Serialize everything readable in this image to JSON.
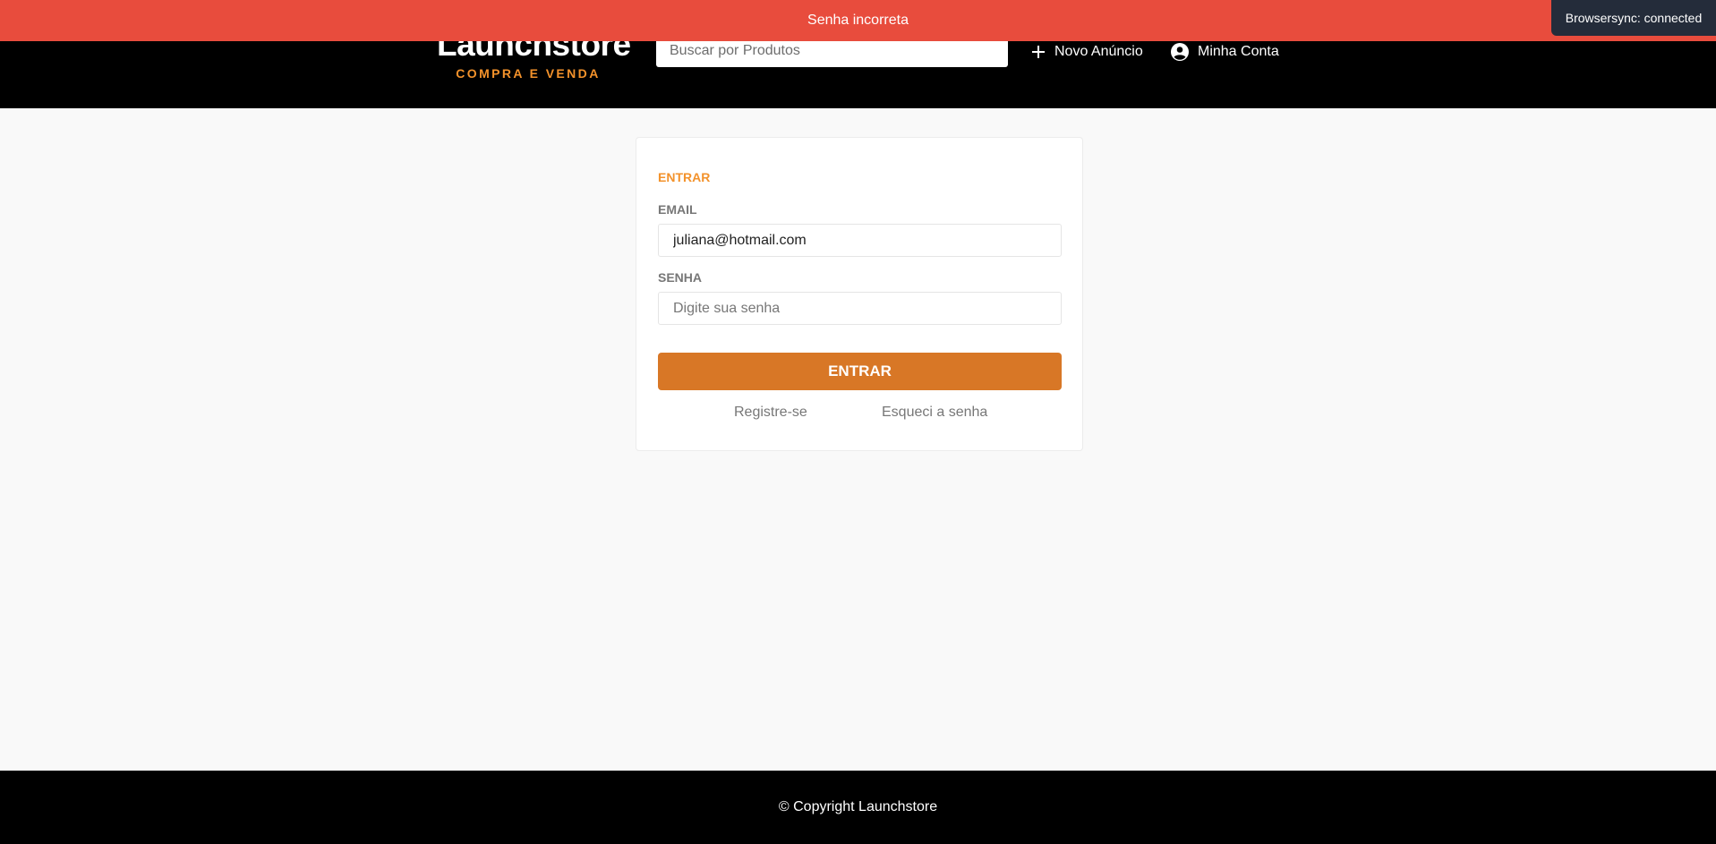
{
  "header": {
    "logo_title": "Launchstore",
    "logo_subtitle": "COMPRA E VENDA",
    "search_placeholder": "Buscar por Produtos",
    "nav": {
      "new_listing": "Novo Anúncio",
      "account": "Minha Conta"
    }
  },
  "toast": {
    "message": "Senha incorreta",
    "color": "#e84c3d"
  },
  "browsersync": {
    "message": "Browsersync: connected"
  },
  "login": {
    "title": "ENTRAR",
    "email_label": "EMAIL",
    "email_value": "juliana@hotmail.com",
    "password_label": "SENHA",
    "password_placeholder": "Digite sua senha",
    "submit_label": "ENTRAR",
    "register_link": "Registre-se",
    "forgot_link": "Esqueci a senha"
  },
  "footer": {
    "copyright": "© Copyright Launchstore"
  },
  "colors": {
    "accent": "#f3922b",
    "button": "#d87726",
    "header_bg": "#000000"
  },
  "icons": {
    "new_listing": "plus-icon",
    "account": "account-circle-icon"
  }
}
